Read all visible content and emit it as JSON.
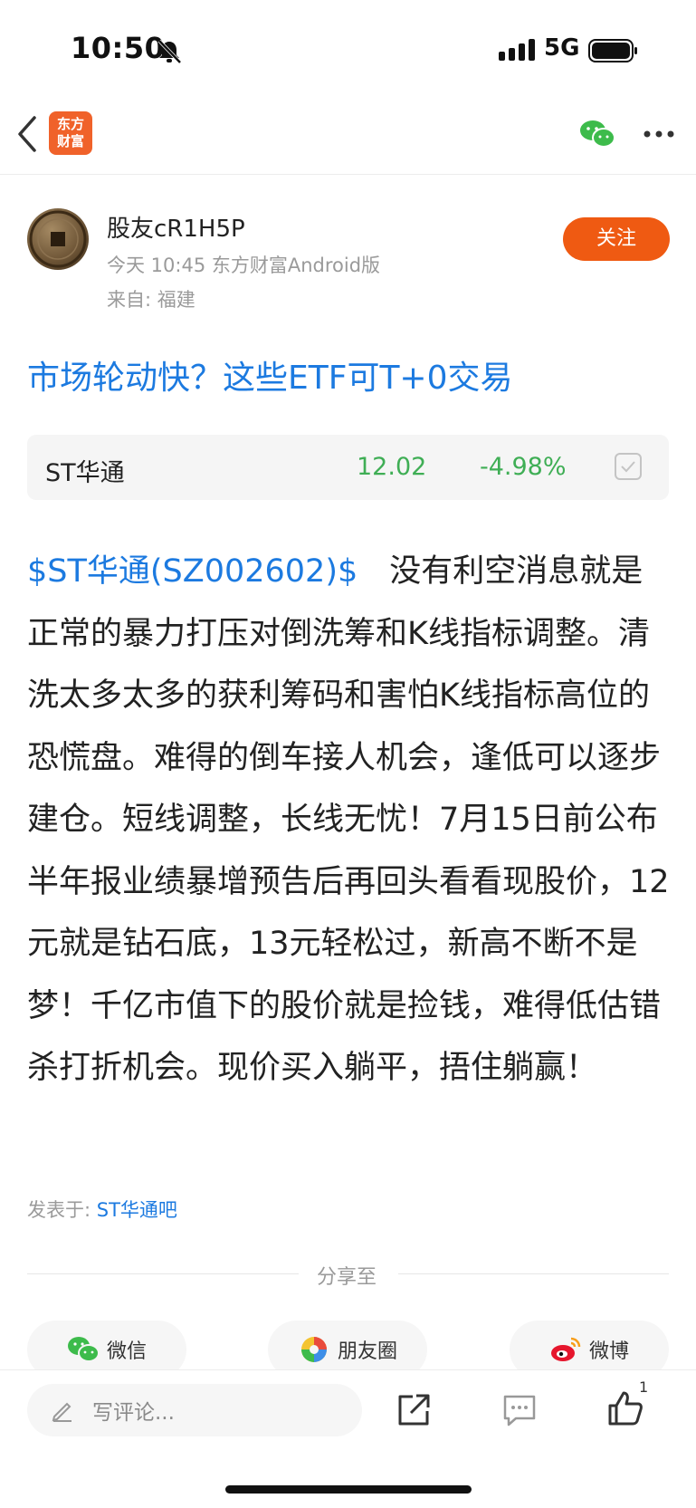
{
  "status_bar": {
    "time": "10:50",
    "network": "5G"
  },
  "nav": {
    "logo_line1": "东方",
    "logo_line2": "财富"
  },
  "author": {
    "name": "股友cR1H5P",
    "meta": "今天 10:45 东方财富Android版",
    "location": "来自: 福建",
    "follow_label": "关注"
  },
  "promo_title": "市场轮动快？这些ETF可T+0交易",
  "stock": {
    "name": "ST华通",
    "price": "12.02",
    "change": "-4.98%"
  },
  "post": {
    "tag": "$ST华通(SZ002602)$",
    "body": "没有利空消息就是正常的暴力打压对倒洗筹和K线指标调整。清洗太多太多的获利筹码和害怕K线指标高位的恐慌盘。难得的倒车接人机会，逢低可以逐步建仓。短线调整，长线无忧！7月15日前公布半年报业绩暴增预告后再回头看看现股价，12元就是钻石底，13元轻松过，新高不断不是梦！千亿市值下的股价就是捡钱，难得低估错杀打折机会。现价买入躺平，捂住躺赢！"
  },
  "posted_in": {
    "label": "发表于:",
    "bar_name": "ST华通吧"
  },
  "share": {
    "label": "分享至",
    "wechat": "微信",
    "moments": "朋友圈",
    "weibo": "微博"
  },
  "bottom": {
    "comment_placeholder": "写评论...",
    "like_count": "1"
  },
  "colors": {
    "accent": "#1c7ae0",
    "brand": "#ef5a12",
    "down": "#3fae55"
  }
}
